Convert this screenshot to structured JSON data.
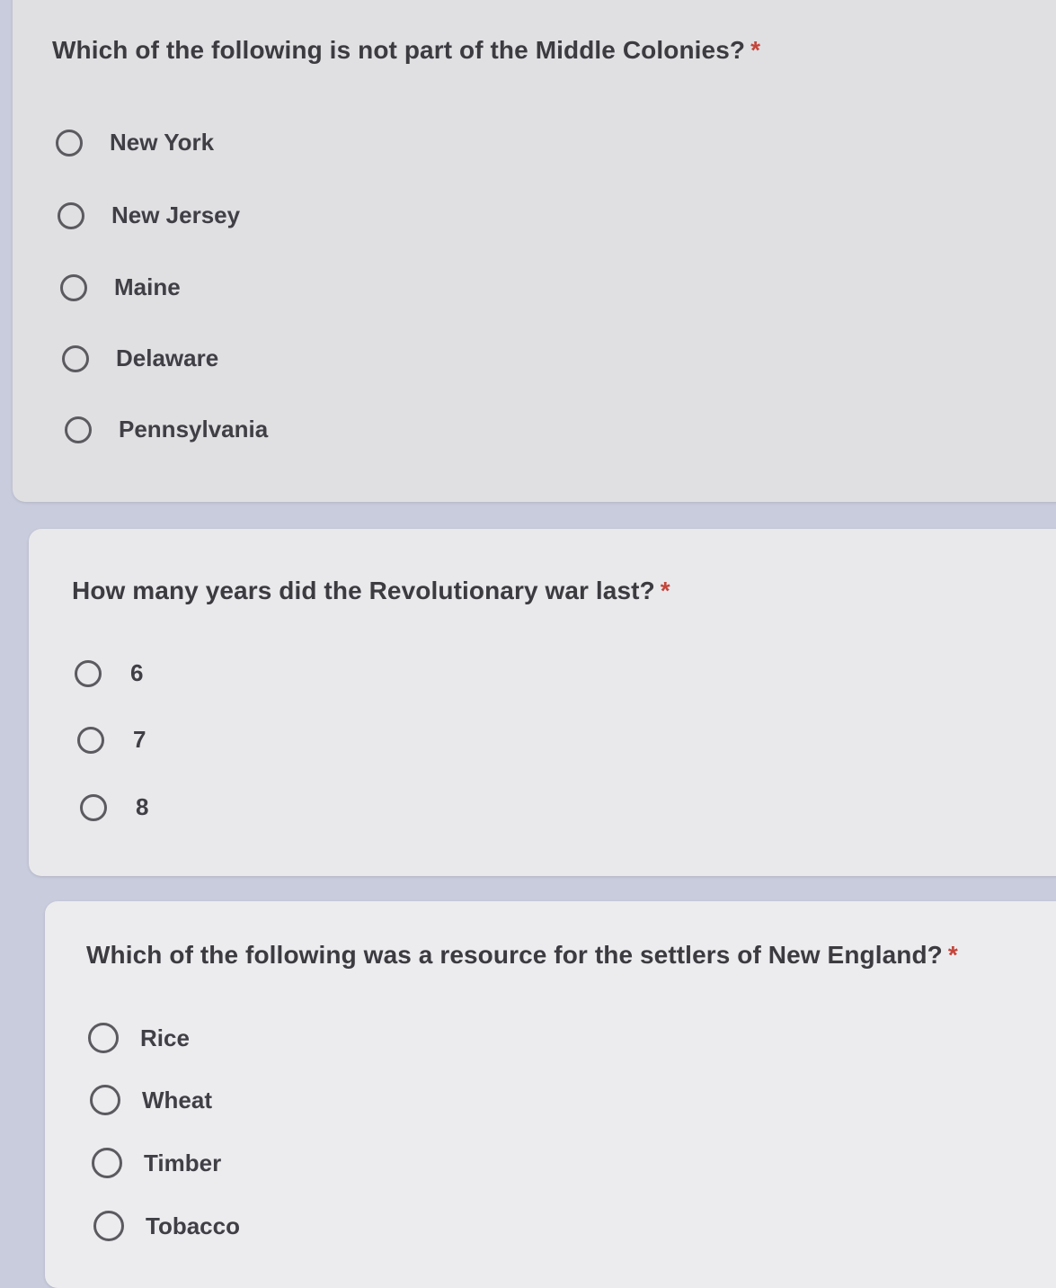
{
  "questions": [
    {
      "text": "Which of the following is not part of the Middle Colonies?",
      "required_mark": "*",
      "options": [
        "New York",
        "New Jersey",
        "Maine",
        "Delaware",
        "Pennsylvania"
      ]
    },
    {
      "text": "How many years did the Revolutionary war last?",
      "required_mark": "*",
      "options": [
        "6",
        "7",
        "8"
      ]
    },
    {
      "text": "Which of the following was a resource for the settlers of New England?",
      "required_mark": "*",
      "options": [
        "Rice",
        "Wheat",
        "Timber",
        "Tobacco"
      ]
    }
  ],
  "colors": {
    "page_background": "#c9ccdd",
    "card_background": "#e6e6e9",
    "required_mark": "#c4453a",
    "text": "#3b3b40"
  }
}
